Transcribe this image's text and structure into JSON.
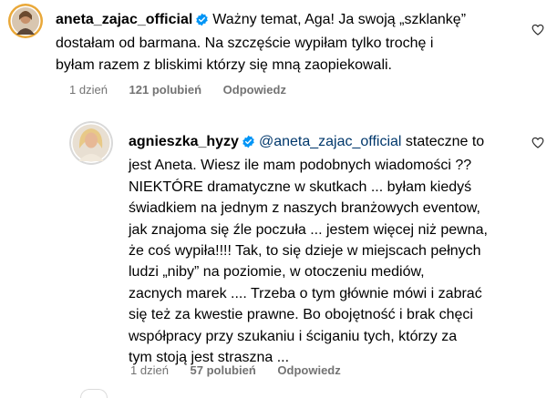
{
  "comments": [
    {
      "username": "aneta_zajac_official",
      "verified": true,
      "lines": [
        "Ważny temat, Aga! Ja swoją „szklankę”",
        "dostałam od barmana. Na szczęście wypiłam tylko trochę i",
        "byłam razem z bliskimi którzy się mną zaopiekowali."
      ],
      "time": "1 dzień",
      "likes": "121 polubień",
      "reply": "Odpowiedz",
      "icons": [
        "avatar",
        "verified-badge-icon",
        "heart-icon"
      ]
    },
    {
      "username": "agnieszka_hyzy",
      "verified": true,
      "mention": "@aneta_zajac_official",
      "lines": [
        "stateczne to",
        "jest Aneta. Wiesz ile mam podobnych wiadomości ??",
        "NIEKTÓRE dramatyczne w skutkach ... byłam kiedyś",
        "świadkiem na jednym z naszych branżowych eventow,",
        "jak znajoma się źle poczuła ... jestem więcej niż pewna,",
        "że coś wypiła!!!! Tak, to się dzieje w miejscach pełnych",
        "ludzi „niby” na poziomie, w otoczeniu mediów,",
        "zacnych marek .... Trzeba o tym głównie mówi i zabrać",
        "się też za kwestie prawne. Bo obojętność i brak chęci",
        "współpracy przy szukaniu i ściganiu tych, którzy za",
        "tym stoją jest straszna ..."
      ],
      "time": "1 dzień",
      "likes": "57 polubień",
      "reply": "Odpowiedz",
      "icons": [
        "avatar",
        "verified-badge-icon",
        "heart-icon"
      ]
    }
  ],
  "colors": {
    "text": "#000000",
    "meta": "#737373",
    "mention": "#00376b",
    "verified": "#0095f6"
  }
}
